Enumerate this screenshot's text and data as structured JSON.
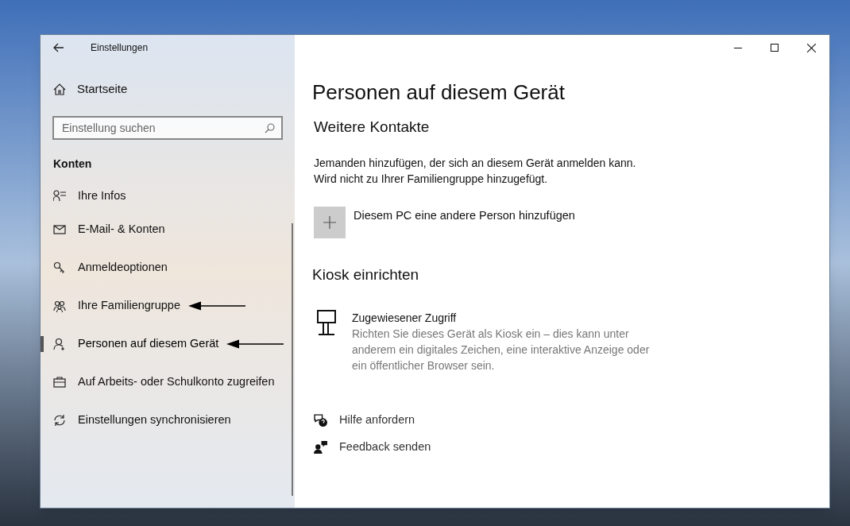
{
  "window": {
    "title": "Einstellungen"
  },
  "sidebar": {
    "home": "Startseite",
    "search": {
      "placeholder": "Einstellung suchen"
    },
    "section": "Konten",
    "items": [
      {
        "label": "Ihre Infos",
        "kind": "info",
        "selected": false
      },
      {
        "label": "E-Mail- & Konten",
        "kind": "mail",
        "selected": false
      },
      {
        "label": "Anmeldeoptionen",
        "kind": "key",
        "selected": false
      },
      {
        "label": "Ihre Familiengruppe",
        "kind": "family",
        "selected": false,
        "annotated": true
      },
      {
        "label": "Personen auf diesem Gerät",
        "kind": "person",
        "selected": true,
        "annotated": true
      },
      {
        "label": "Auf Arbeits- oder Schulkonto zugreifen",
        "kind": "briefcase",
        "selected": false
      },
      {
        "label": "Einstellungen synchronisieren",
        "kind": "sync",
        "selected": false
      }
    ]
  },
  "main": {
    "title": "Personen auf diesem Gerät",
    "other_contacts": {
      "heading": "Weitere Kontakte",
      "description_lines": [
        "Jemanden hinzufügen, der sich an diesem Gerät anmelden kann.",
        "Wird nicht zu Ihrer Familiengruppe hinzugefügt."
      ],
      "add_button": "Diesem PC eine andere Person hinzufügen"
    },
    "kiosk": {
      "heading": "Kiosk einrichten",
      "item_title": "Zugewiesener Zugriff",
      "item_description": "Richten Sie dieses Gerät als Kiosk ein – dies kann unter anderem ein digitales Zeichen, eine interaktive Anzeige oder ein öffentlicher Browser sein."
    },
    "links": [
      {
        "label": "Hilfe anfordern",
        "kind": "help"
      },
      {
        "label": "Feedback senden",
        "kind": "feedback"
      }
    ]
  }
}
